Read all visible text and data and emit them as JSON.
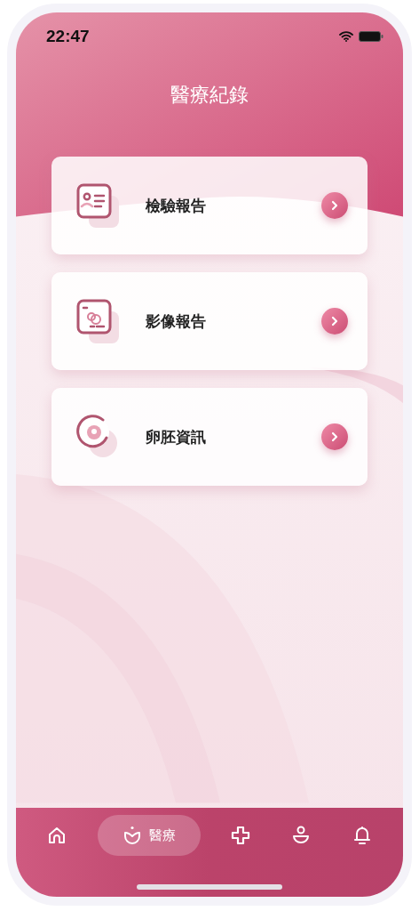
{
  "status_bar": {
    "time": "22:47"
  },
  "title": "醫療紀錄",
  "records": [
    {
      "label": "檢驗報告",
      "kind": "report"
    },
    {
      "label": "影像報告",
      "kind": "image"
    },
    {
      "label": "卵胚資訊",
      "kind": "embryo"
    }
  ],
  "nav": [
    {
      "kind": "home",
      "selected": false
    },
    {
      "kind": "medical",
      "label": "醫療",
      "selected": true
    },
    {
      "kind": "add",
      "selected": false
    },
    {
      "kind": "profile",
      "selected": false
    },
    {
      "kind": "bell",
      "selected": false
    }
  ]
}
